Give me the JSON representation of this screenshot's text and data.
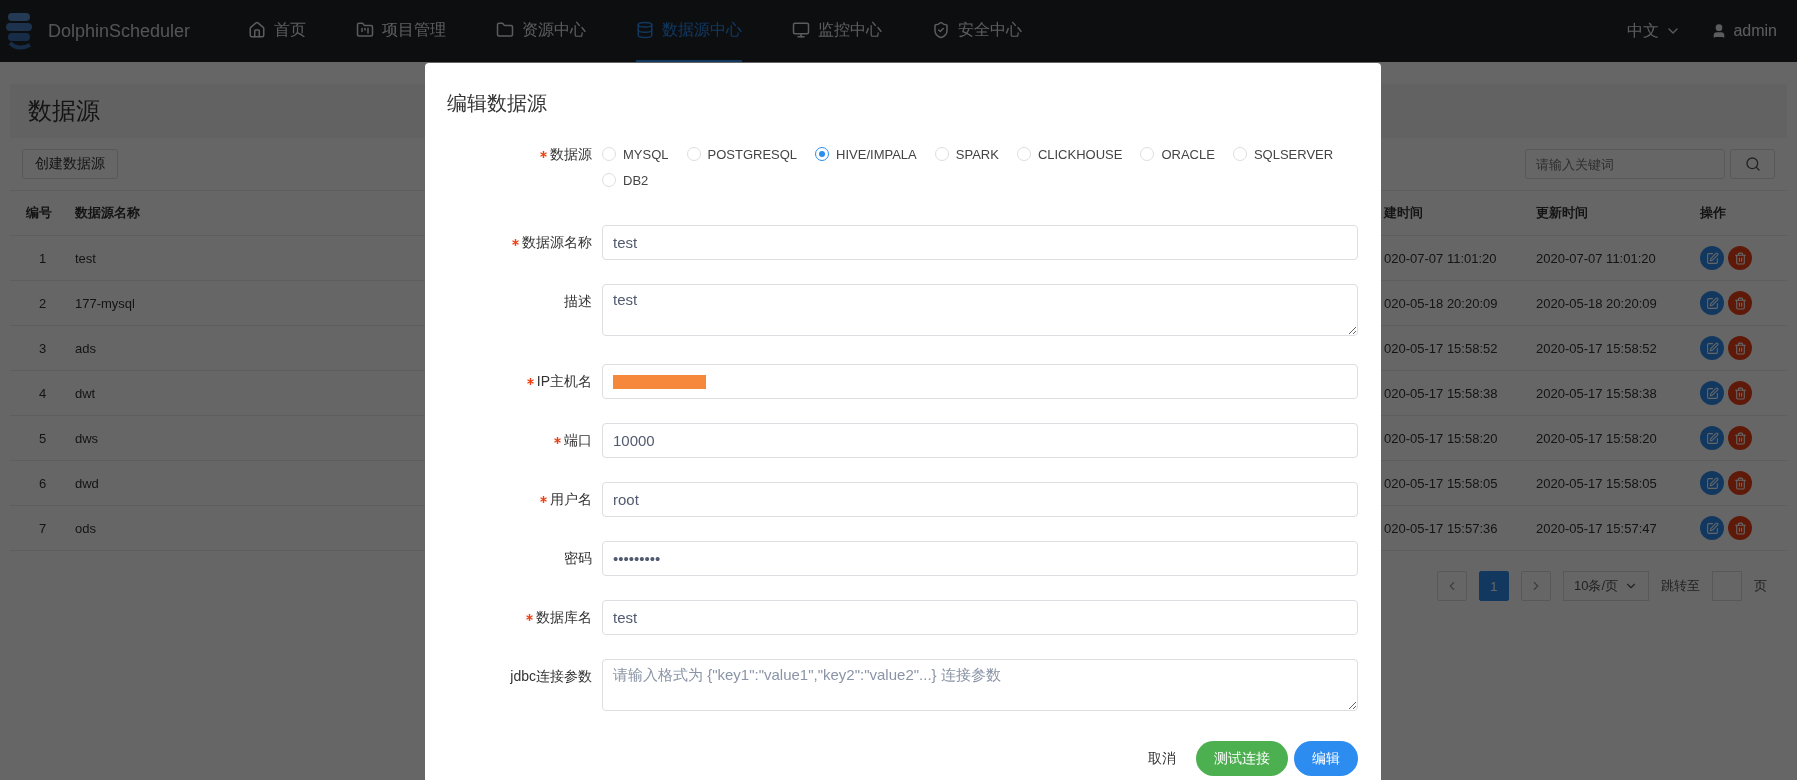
{
  "nav": {
    "brand": "DolphinScheduler",
    "items": [
      {
        "label": "首页",
        "selected": false
      },
      {
        "label": "项目管理",
        "selected": false
      },
      {
        "label": "资源中心",
        "selected": false
      },
      {
        "label": "数据源中心",
        "selected": true
      },
      {
        "label": "监控中心",
        "selected": false
      },
      {
        "label": "安全中心",
        "selected": false
      }
    ],
    "language": "中文",
    "user": "admin"
  },
  "page": {
    "title": "数据源",
    "create_button": "创建数据源",
    "search": {
      "placeholder": "请输入关键词"
    },
    "table": {
      "columns": [
        "编号",
        "数据源名称",
        "建时间",
        "更新时间",
        "操作"
      ],
      "rows": [
        {
          "id": "1",
          "name": "test",
          "created": "020-07-07 11:01:20",
          "updated": "2020-07-07 11:01:20"
        },
        {
          "id": "2",
          "name": "177-mysql",
          "created": "020-05-18 20:20:09",
          "updated": "2020-05-18 20:20:09"
        },
        {
          "id": "3",
          "name": "ads",
          "created": "020-05-17 15:58:52",
          "updated": "2020-05-17 15:58:52"
        },
        {
          "id": "4",
          "name": "dwt",
          "created": "020-05-17 15:58:38",
          "updated": "2020-05-17 15:58:38"
        },
        {
          "id": "5",
          "name": "dws",
          "created": "020-05-17 15:58:20",
          "updated": "2020-05-17 15:58:20"
        },
        {
          "id": "6",
          "name": "dwd",
          "created": "020-05-17 15:58:05",
          "updated": "2020-05-17 15:58:05"
        },
        {
          "id": "7",
          "name": "ods",
          "created": "020-05-17 15:57:36",
          "updated": "2020-05-17 15:57:47"
        }
      ]
    },
    "pagination": {
      "pages": [
        {
          "label": "1",
          "selected": true
        }
      ],
      "page_size": "10条/页",
      "jump_label": "跳转至",
      "page_suffix": "页"
    }
  },
  "dialog": {
    "title": "编辑数据源",
    "fields": [
      {
        "kind": "radio",
        "label": "数据源",
        "required": true,
        "options": [
          {
            "label": "MYSQL",
            "selected": false
          },
          {
            "label": "POSTGRESQL",
            "selected": false
          },
          {
            "label": "HIVE/IMPALA",
            "selected": true
          },
          {
            "label": "SPARK",
            "selected": false
          },
          {
            "label": "CLICKHOUSE",
            "selected": false
          },
          {
            "label": "ORACLE",
            "selected": false
          },
          {
            "label": "SQLSERVER",
            "selected": false
          },
          {
            "label": "DB2",
            "selected": false
          }
        ]
      },
      {
        "kind": "input",
        "label": "数据源名称",
        "required": true,
        "value": "test"
      },
      {
        "kind": "textarea",
        "label": "描述",
        "required": false,
        "value": "test"
      },
      {
        "kind": "redacted",
        "label": "IP主机名",
        "required": true
      },
      {
        "kind": "input",
        "label": "端口",
        "required": true,
        "value": "10000"
      },
      {
        "kind": "input",
        "label": "用户名",
        "required": true,
        "value": "root"
      },
      {
        "kind": "input",
        "label": "密码",
        "required": false,
        "value": "•••••••••"
      },
      {
        "kind": "input",
        "label": "数据库名",
        "required": true,
        "value": "test"
      },
      {
        "kind": "textarea",
        "label": "jdbc连接参数",
        "required": false,
        "placeholder": "请输入格式为 {\"key1\":\"value1\",\"key2\":\"value2\"...} 连接参数"
      }
    ],
    "buttons": [
      {
        "label": "取消",
        "kind": "text"
      },
      {
        "label": "测试连接",
        "kind": "success"
      },
      {
        "label": "编辑",
        "kind": "primary"
      }
    ]
  }
}
